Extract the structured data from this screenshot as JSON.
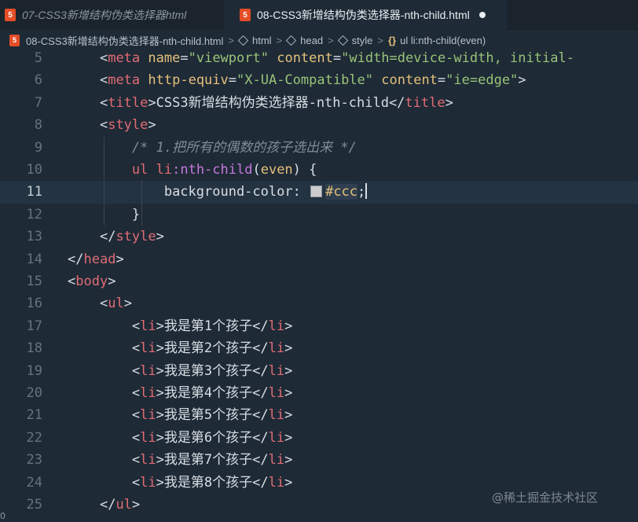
{
  "tabs": [
    {
      "label": "07-CSS3新增结构伪类选择器html",
      "icon": "html5-icon",
      "active": false
    },
    {
      "label": "08-CSS3新增结构伪类选择器-nth-child.html",
      "icon": "html5-icon",
      "active": true,
      "dirty": true
    }
  ],
  "breadcrumb": {
    "file": "08-CSS3新增结构伪类选择器-nth-child.html",
    "html": "html",
    "head": "head",
    "style": "style",
    "rule": "ul li:nth-child(even)",
    "sep": ">"
  },
  "html_icon_glyph": "5",
  "selector_icon_glyph": "{}",
  "editor": {
    "current_line": 11,
    "lines": [
      {
        "num": "5",
        "tokens": [
          [
            "    ",
            "br"
          ],
          [
            "<",
            "br"
          ],
          [
            "meta",
            "tag"
          ],
          [
            " ",
            "br"
          ],
          [
            "name",
            "attr"
          ],
          [
            "=",
            "br"
          ],
          [
            "\"viewport\"",
            "str"
          ],
          [
            " ",
            "br"
          ],
          [
            "content",
            "attr"
          ],
          [
            "=",
            "br"
          ],
          [
            "\"width=device-width, initial-",
            "str"
          ]
        ]
      },
      {
        "num": "6",
        "tokens": [
          [
            "    ",
            "br"
          ],
          [
            "<",
            "br"
          ],
          [
            "meta",
            "tag"
          ],
          [
            " ",
            "br"
          ],
          [
            "http-equiv",
            "attr"
          ],
          [
            "=",
            "br"
          ],
          [
            "\"X-UA-Compatible\"",
            "str"
          ],
          [
            " ",
            "br"
          ],
          [
            "content",
            "attr"
          ],
          [
            "=",
            "br"
          ],
          [
            "\"ie=edge\"",
            "str"
          ],
          [
            ">",
            "br"
          ]
        ]
      },
      {
        "num": "7",
        "tokens": [
          [
            "    ",
            "br"
          ],
          [
            "<",
            "br"
          ],
          [
            "title",
            "tag"
          ],
          [
            ">",
            "br"
          ],
          [
            "CSS3新增结构伪类选择器-nth-child",
            "text"
          ],
          [
            "</",
            "br"
          ],
          [
            "title",
            "tag"
          ],
          [
            ">",
            "br"
          ]
        ]
      },
      {
        "num": "8",
        "tokens": [
          [
            "    ",
            "br"
          ],
          [
            "<",
            "br"
          ],
          [
            "style",
            "tag"
          ],
          [
            ">",
            "br"
          ]
        ]
      },
      {
        "num": "9",
        "tokens": [
          [
            "        ",
            "br"
          ],
          [
            "/* 1.把所有的偶数的孩子选出来 */",
            "cmt"
          ]
        ]
      },
      {
        "num": "10",
        "tokens": [
          [
            "        ",
            "br"
          ],
          [
            "ul",
            "sel"
          ],
          [
            " ",
            "br"
          ],
          [
            "li",
            "sel"
          ],
          [
            ":nth-child",
            "pseudo"
          ],
          [
            "(",
            "paren"
          ],
          [
            "even",
            "arg"
          ],
          [
            ")",
            "paren"
          ],
          [
            " {",
            "br"
          ]
        ]
      },
      {
        "num": "11",
        "tokens": [
          [
            "            ",
            "br"
          ],
          [
            "background-color",
            "prop"
          ],
          [
            ": ",
            "br"
          ],
          [
            "",
            "swatch"
          ],
          [
            "#ccc",
            "valhl"
          ],
          [
            ";",
            "br"
          ],
          [
            "",
            "cursor"
          ]
        ]
      },
      {
        "num": "12",
        "tokens": [
          [
            "        ",
            "br"
          ],
          [
            "}",
            "br"
          ]
        ]
      },
      {
        "num": "13",
        "tokens": [
          [
            "    ",
            "br"
          ],
          [
            "</",
            "br"
          ],
          [
            "style",
            "tag"
          ],
          [
            ">",
            "br"
          ]
        ]
      },
      {
        "num": "14",
        "tokens": [
          [
            "</",
            "br"
          ],
          [
            "head",
            "tag"
          ],
          [
            ">",
            "br"
          ]
        ]
      },
      {
        "num": "15",
        "tokens": [
          [
            "<",
            "br"
          ],
          [
            "body",
            "tag"
          ],
          [
            ">",
            "br"
          ]
        ]
      },
      {
        "num": "16",
        "tokens": [
          [
            "    ",
            "br"
          ],
          [
            "<",
            "br"
          ],
          [
            "ul",
            "tag"
          ],
          [
            ">",
            "br"
          ]
        ]
      },
      {
        "num": "17",
        "tokens": [
          [
            "        ",
            "br"
          ],
          [
            "<",
            "br"
          ],
          [
            "li",
            "tag"
          ],
          [
            ">",
            "br"
          ],
          [
            "我是第",
            "text"
          ],
          [
            "1",
            "text"
          ],
          [
            "个孩子",
            "text"
          ],
          [
            "</",
            "br"
          ],
          [
            "li",
            "tag"
          ],
          [
            ">",
            "br"
          ]
        ]
      },
      {
        "num": "18",
        "tokens": [
          [
            "        ",
            "br"
          ],
          [
            "<",
            "br"
          ],
          [
            "li",
            "tag"
          ],
          [
            ">",
            "br"
          ],
          [
            "我是第",
            "text"
          ],
          [
            "2",
            "text"
          ],
          [
            "个孩子",
            "text"
          ],
          [
            "</",
            "br"
          ],
          [
            "li",
            "tag"
          ],
          [
            ">",
            "br"
          ]
        ]
      },
      {
        "num": "19",
        "tokens": [
          [
            "        ",
            "br"
          ],
          [
            "<",
            "br"
          ],
          [
            "li",
            "tag"
          ],
          [
            ">",
            "br"
          ],
          [
            "我是第",
            "text"
          ],
          [
            "3",
            "text"
          ],
          [
            "个孩子",
            "text"
          ],
          [
            "</",
            "br"
          ],
          [
            "li",
            "tag"
          ],
          [
            ">",
            "br"
          ]
        ]
      },
      {
        "num": "20",
        "tokens": [
          [
            "        ",
            "br"
          ],
          [
            "<",
            "br"
          ],
          [
            "li",
            "tag"
          ],
          [
            ">",
            "br"
          ],
          [
            "我是第",
            "text"
          ],
          [
            "4",
            "text"
          ],
          [
            "个孩子",
            "text"
          ],
          [
            "</",
            "br"
          ],
          [
            "li",
            "tag"
          ],
          [
            ">",
            "br"
          ]
        ]
      },
      {
        "num": "21",
        "tokens": [
          [
            "        ",
            "br"
          ],
          [
            "<",
            "br"
          ],
          [
            "li",
            "tag"
          ],
          [
            ">",
            "br"
          ],
          [
            "我是第",
            "text"
          ],
          [
            "5",
            "text"
          ],
          [
            "个孩子",
            "text"
          ],
          [
            "</",
            "br"
          ],
          [
            "li",
            "tag"
          ],
          [
            ">",
            "br"
          ]
        ]
      },
      {
        "num": "22",
        "tokens": [
          [
            "        ",
            "br"
          ],
          [
            "<",
            "br"
          ],
          [
            "li",
            "tag"
          ],
          [
            ">",
            "br"
          ],
          [
            "我是第",
            "text"
          ],
          [
            "6",
            "text"
          ],
          [
            "个孩子",
            "text"
          ],
          [
            "</",
            "br"
          ],
          [
            "li",
            "tag"
          ],
          [
            ">",
            "br"
          ]
        ]
      },
      {
        "num": "23",
        "tokens": [
          [
            "        ",
            "br"
          ],
          [
            "<",
            "br"
          ],
          [
            "li",
            "tag"
          ],
          [
            ">",
            "br"
          ],
          [
            "我是第",
            "text"
          ],
          [
            "7",
            "text"
          ],
          [
            "个孩子",
            "text"
          ],
          [
            "</",
            "br"
          ],
          [
            "li",
            "tag"
          ],
          [
            ">",
            "br"
          ]
        ]
      },
      {
        "num": "24",
        "tokens": [
          [
            "        ",
            "br"
          ],
          [
            "<",
            "br"
          ],
          [
            "li",
            "tag"
          ],
          [
            ">",
            "br"
          ],
          [
            "我是第",
            "text"
          ],
          [
            "8",
            "text"
          ],
          [
            "个孩子",
            "text"
          ],
          [
            "</",
            "br"
          ],
          [
            "li",
            "tag"
          ],
          [
            ">",
            "br"
          ]
        ]
      },
      {
        "num": "25",
        "tokens": [
          [
            "    ",
            "br"
          ],
          [
            "</",
            "br"
          ],
          [
            "ul",
            "tag"
          ],
          [
            ">",
            "br"
          ]
        ]
      }
    ]
  },
  "watermark": "@稀土掘金技术社区",
  "corner_text": "0",
  "colors": {
    "background": "#1e2a36",
    "tag": "#e06c75",
    "attribute": "#e5c07b",
    "string": "#98c379",
    "comment": "#7f8c98",
    "pseudo": "#c678dd",
    "swatch": "#cccccc"
  }
}
